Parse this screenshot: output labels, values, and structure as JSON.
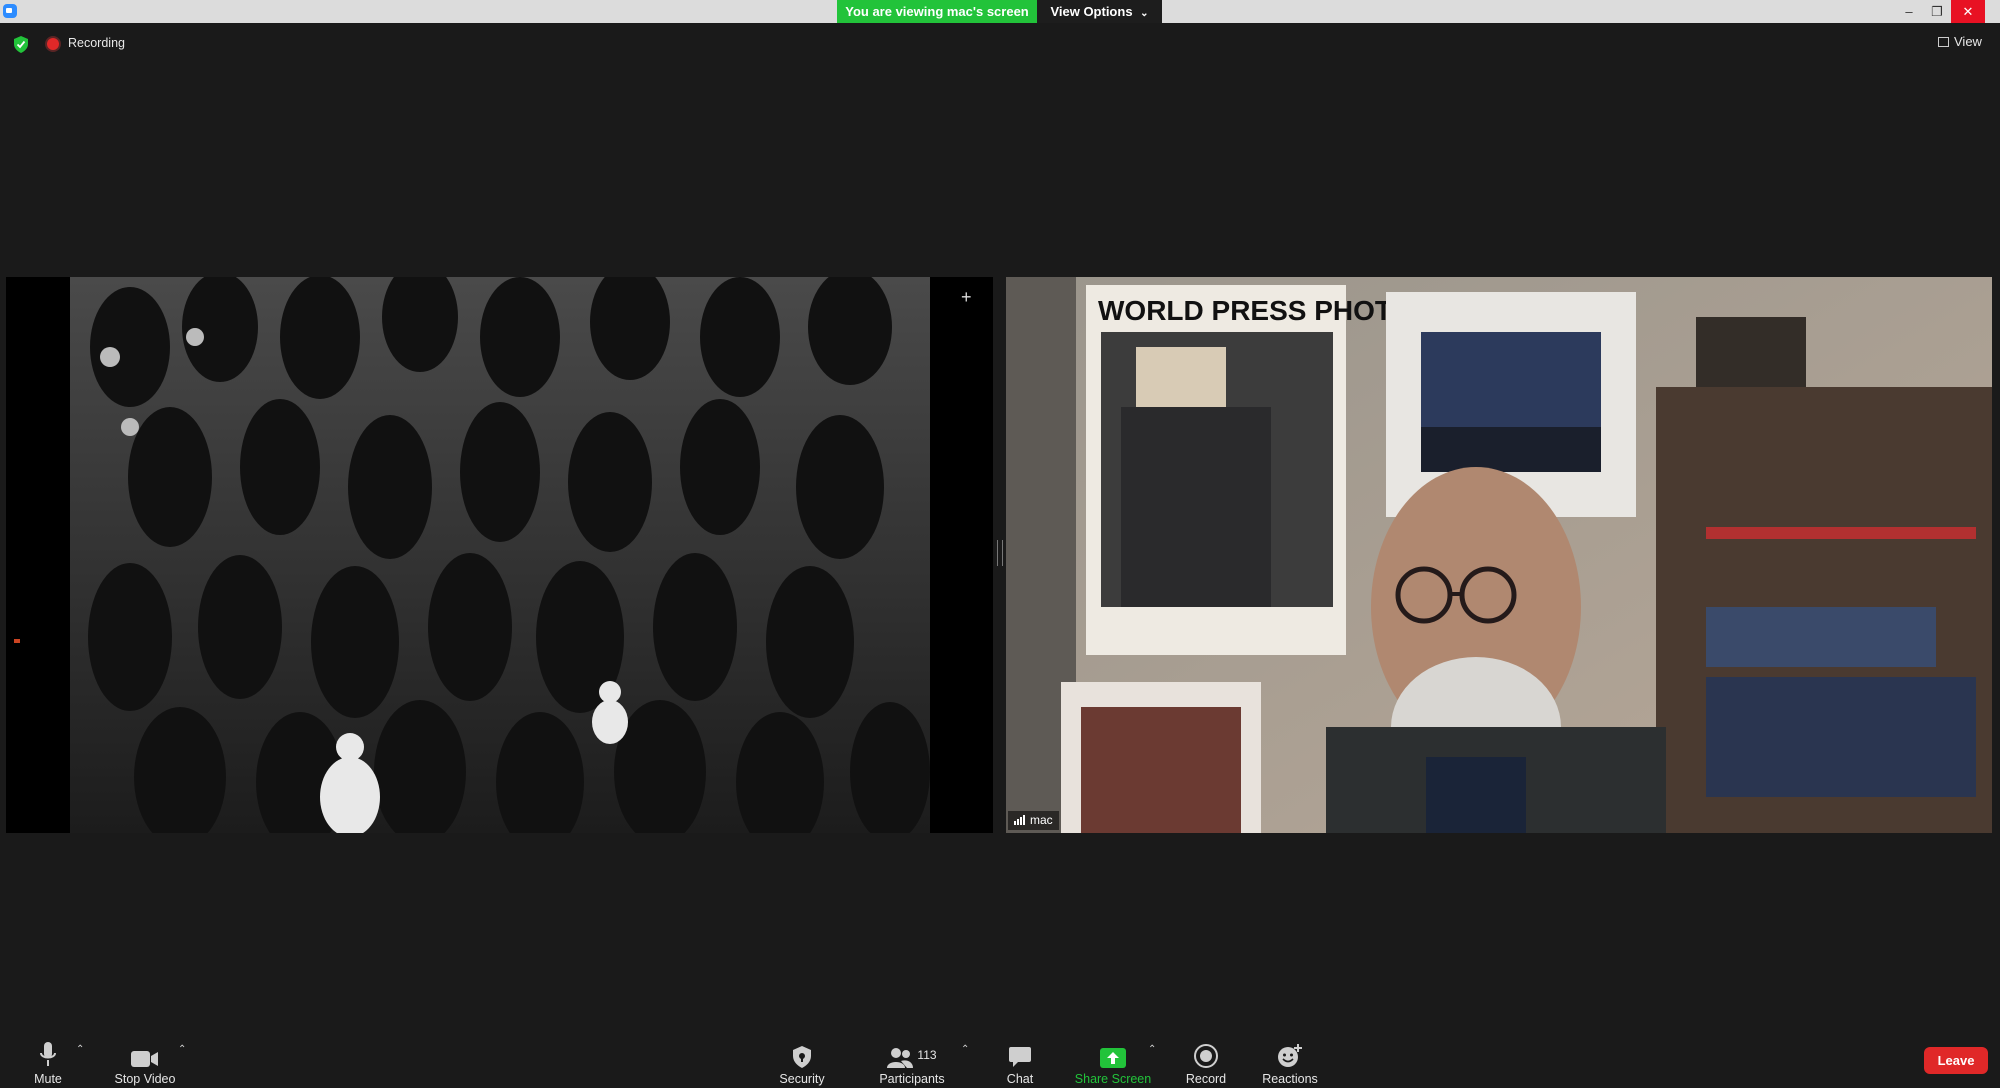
{
  "titlebar": {
    "banner": "You are viewing mac's screen",
    "view_options": "View Options",
    "window_controls": [
      "minimize",
      "restore",
      "close"
    ]
  },
  "status": {
    "recording_label": "Recording",
    "view_label": "View"
  },
  "panels": {
    "shared_screen": {
      "content": "photo"
    },
    "participant_video": {
      "name": "mac"
    }
  },
  "toolbar": {
    "mute": "Mute",
    "stop_video": "Stop Video",
    "security": "Security",
    "participants": "Participants",
    "participants_count": "113",
    "chat": "Chat",
    "share_screen": "Share Screen",
    "record": "Record",
    "reactions": "Reactions",
    "leave": "Leave"
  },
  "colors": {
    "banner_green": "#22c33a",
    "leave_red": "#e02828",
    "background": "#1a1a1a",
    "share_green": "#22c33a"
  }
}
